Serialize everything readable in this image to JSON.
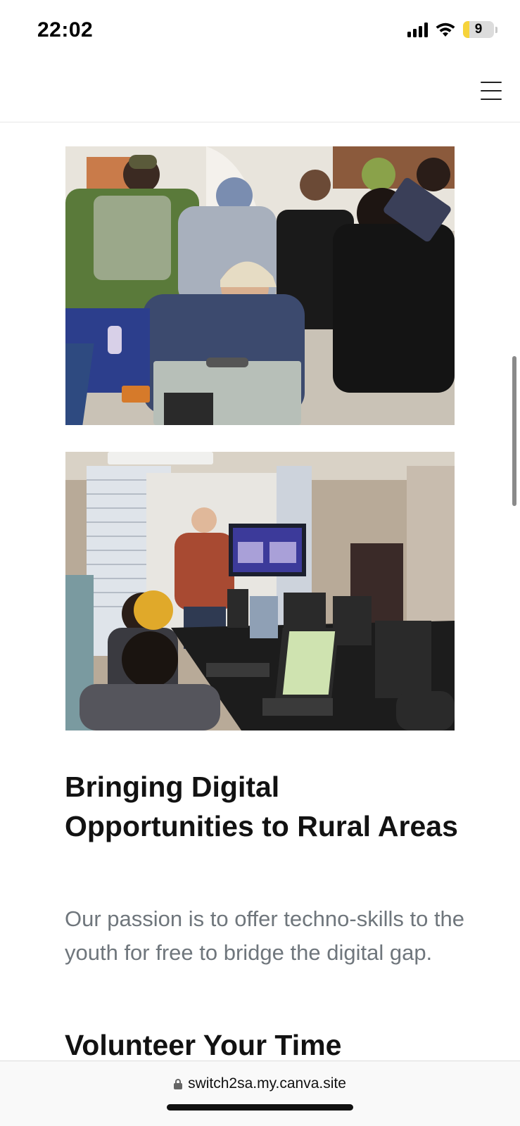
{
  "status_bar": {
    "time": "22:02",
    "battery_level": "9",
    "icons": [
      "signal-icon",
      "wifi-icon",
      "battery-icon"
    ]
  },
  "header": {
    "menu_icon": "hamburger-menu-icon"
  },
  "photos": [
    {
      "name": "group-at-computer-photo"
    },
    {
      "name": "classroom-presentation-photo"
    }
  ],
  "content": {
    "heading": "Bringing Digital Opportunities to Rural Areas",
    "paragraph": "Our passion is to offer techno-skills to the youth for free to bridge the digital gap.",
    "heading_2": "Volunteer Your Time"
  },
  "browser": {
    "url": "switch2sa.my.canva.site",
    "lock_icon": "lock-icon"
  },
  "colors": {
    "heading": "#121212",
    "paragraph": "#6f767c",
    "battery_fill": "#f6d33b"
  }
}
